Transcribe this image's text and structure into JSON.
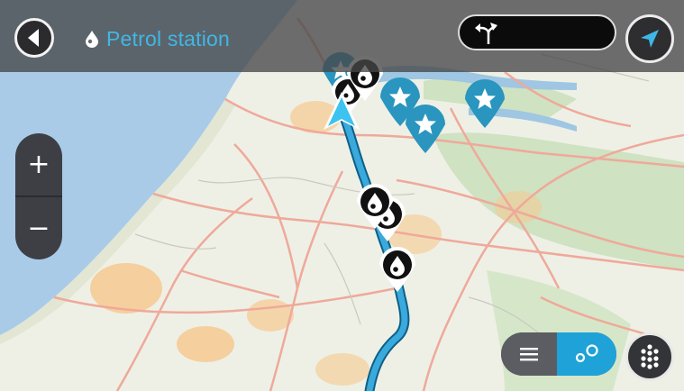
{
  "header": {
    "title": "Petrol station",
    "title_icon": "fuel-drop-icon",
    "back_icon": "back-arrow-icon",
    "search_icon": "turn-instruction-icon",
    "nav_icon": "navigation-arrow-icon"
  },
  "zoom": {
    "in_label": "+",
    "out_label": "−"
  },
  "view_toggle": {
    "list_icon": "list-icon",
    "map_icon": "map-pins-icon",
    "selected": "map"
  },
  "menu": {
    "icon": "grid-dots-icon"
  },
  "map": {
    "markers": [
      {
        "type": "favorite",
        "icon": "star-icon"
      },
      {
        "type": "favorite",
        "icon": "star-icon"
      },
      {
        "type": "favorite",
        "icon": "star-icon"
      },
      {
        "type": "favorite",
        "icon": "star-icon"
      },
      {
        "type": "petrol",
        "icon": "fuel-drop-icon"
      },
      {
        "type": "petrol",
        "icon": "fuel-drop-icon"
      },
      {
        "type": "petrol",
        "icon": "fuel-drop-icon"
      },
      {
        "type": "petrol",
        "icon": "fuel-drop-icon"
      },
      {
        "type": "petrol",
        "icon": "fuel-drop-icon"
      }
    ],
    "colors": {
      "route": "#1f98cf",
      "sea": "#a9cbe8",
      "land": "#eef0e6",
      "accent": "#3fb7e6"
    }
  }
}
